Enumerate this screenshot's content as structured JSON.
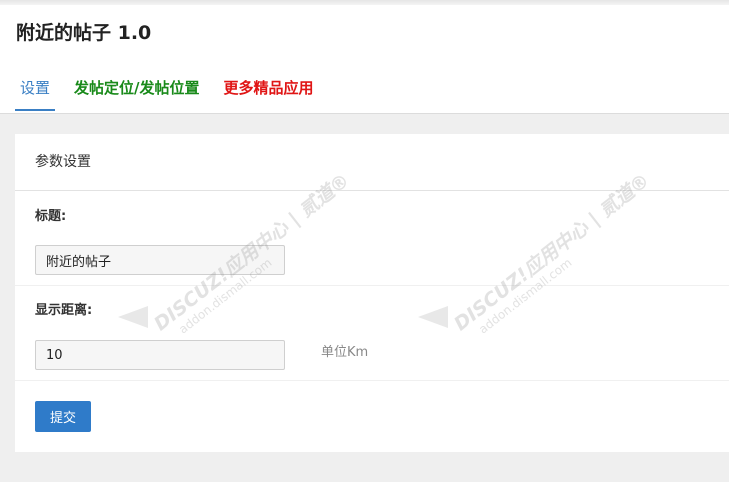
{
  "app": {
    "title": "附近的帖子 1.0"
  },
  "tabs": [
    {
      "label": "设置",
      "active": true,
      "color": "#3a7fc4"
    },
    {
      "label": "发帖定位/发帖位置",
      "active": false,
      "color": "#198a1a"
    },
    {
      "label": "更多精品应用",
      "active": false,
      "color": "#e01515"
    }
  ],
  "panel": {
    "title": "参数设置",
    "fields": [
      {
        "label": "标题:",
        "value": "附近的帖子"
      },
      {
        "label": "显示距离:",
        "value": "10",
        "unit": "单位Km"
      }
    ],
    "submit_label": "提交"
  },
  "watermark": {
    "main": "DISCUZ!应用中心 | 贰道®",
    "sub": "addon.dismall.com"
  },
  "colors": {
    "accent": "#2f7bc9",
    "background": "#efefef",
    "panel": "#ffffff"
  }
}
